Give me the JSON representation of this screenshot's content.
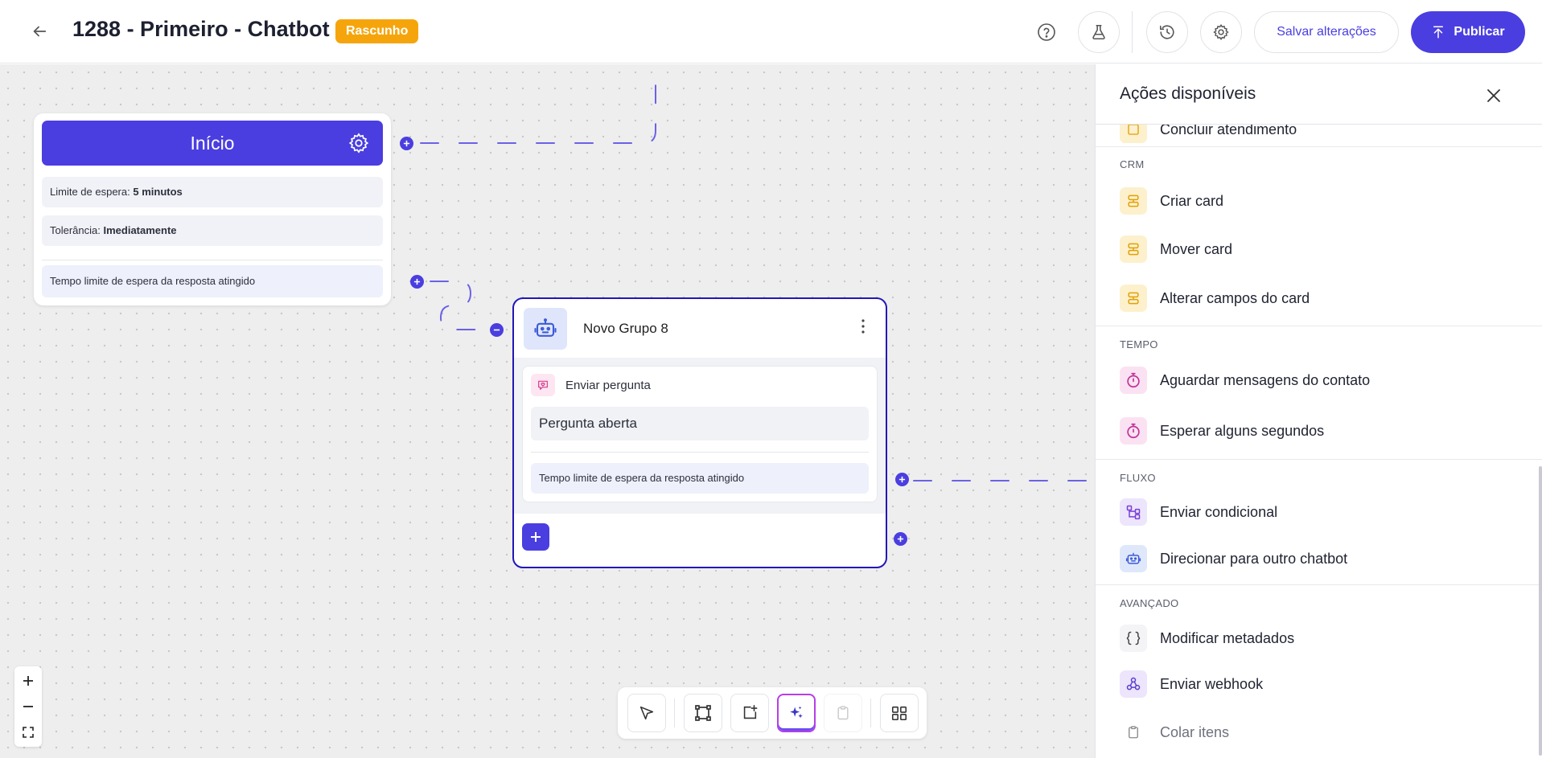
{
  "header": {
    "title": "1288 - Primeiro - Chatbot",
    "badge": "Rascunho",
    "save_label": "Salvar alterações",
    "publish_label": "Publicar"
  },
  "colors": {
    "primary": "#4a3ee0",
    "badge": "#f5a50b",
    "group_border": "#2118b9"
  },
  "start_node": {
    "title": "Início",
    "wait_limit_label": "Limite de espera:",
    "wait_limit_value": "5 minutos",
    "tolerance_label": "Tolerância:",
    "tolerance_value": "Imediatamente",
    "timeout_text": "Tempo limite de espera da resposta atingido"
  },
  "group_node": {
    "title": "Novo Grupo 8",
    "block_label": "Enviar pergunta",
    "answer": "Pergunta aberta",
    "timeout_text": "Tempo limite de espera da resposta atingido"
  },
  "panel": {
    "title": "Ações disponíveis",
    "partial_item": "Concluir atendimento",
    "sections": [
      {
        "label": "CRM",
        "items": [
          {
            "label": "Criar card",
            "icon": "card-icon"
          },
          {
            "label": "Mover card",
            "icon": "card-icon"
          },
          {
            "label": "Alterar campos do card",
            "icon": "card-icon"
          }
        ]
      },
      {
        "label": "TEMPO",
        "items": [
          {
            "label": "Aguardar mensagens do contato",
            "icon": "timer-icon"
          },
          {
            "label": "Esperar alguns segundos",
            "icon": "timer-icon"
          }
        ]
      },
      {
        "label": "FLUXO",
        "items": [
          {
            "label": "Enviar condicional",
            "icon": "branch-icon"
          },
          {
            "label": "Direcionar para outro chatbot",
            "icon": "robot-icon"
          }
        ]
      },
      {
        "label": "AVANÇADO",
        "items": [
          {
            "label": "Modificar metadados",
            "icon": "braces-icon"
          },
          {
            "label": "Enviar webhook",
            "icon": "webhook-icon"
          },
          {
            "label": "Colar itens",
            "icon": "clipboard-icon"
          }
        ]
      }
    ]
  }
}
